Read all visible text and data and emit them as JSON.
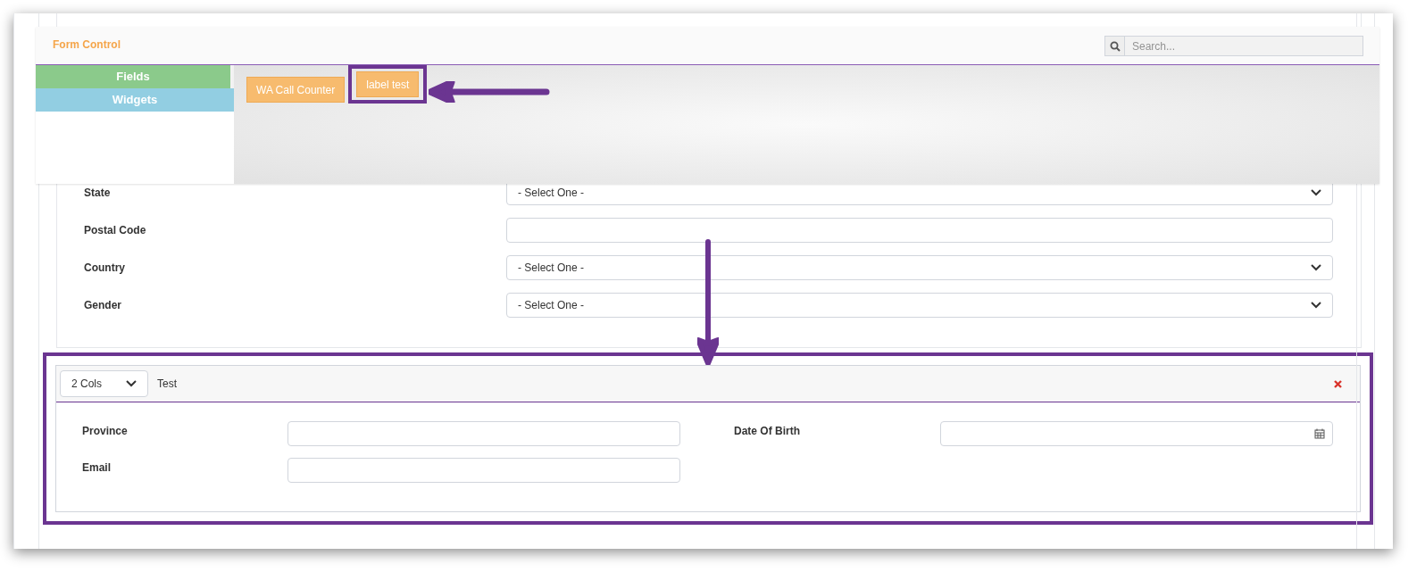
{
  "overlay": {
    "title": "Form Control",
    "search": {
      "placeholder": "Search..."
    },
    "tabs": [
      {
        "label": "Fields",
        "selected": true
      },
      {
        "label": "Widgets",
        "selected": false
      }
    ],
    "widgets": [
      {
        "label": "WA Call Counter",
        "highlighted": false
      },
      {
        "label": "label test",
        "highlighted": true
      }
    ]
  },
  "form": {
    "rows": [
      {
        "label": "State",
        "kind": "select",
        "value": "- Select One -"
      },
      {
        "label": "Postal Code",
        "kind": "text"
      },
      {
        "label": "Country",
        "kind": "select",
        "value": "- Select One -"
      },
      {
        "label": "Gender",
        "kind": "select",
        "value": "- Select One -"
      }
    ]
  },
  "section": {
    "layout": "2 Cols",
    "title": "Test",
    "fields": [
      {
        "label": "Province",
        "kind": "text"
      },
      {
        "label": "Date Of Birth",
        "kind": "date"
      },
      {
        "label": "Email",
        "kind": "text"
      }
    ]
  }
}
